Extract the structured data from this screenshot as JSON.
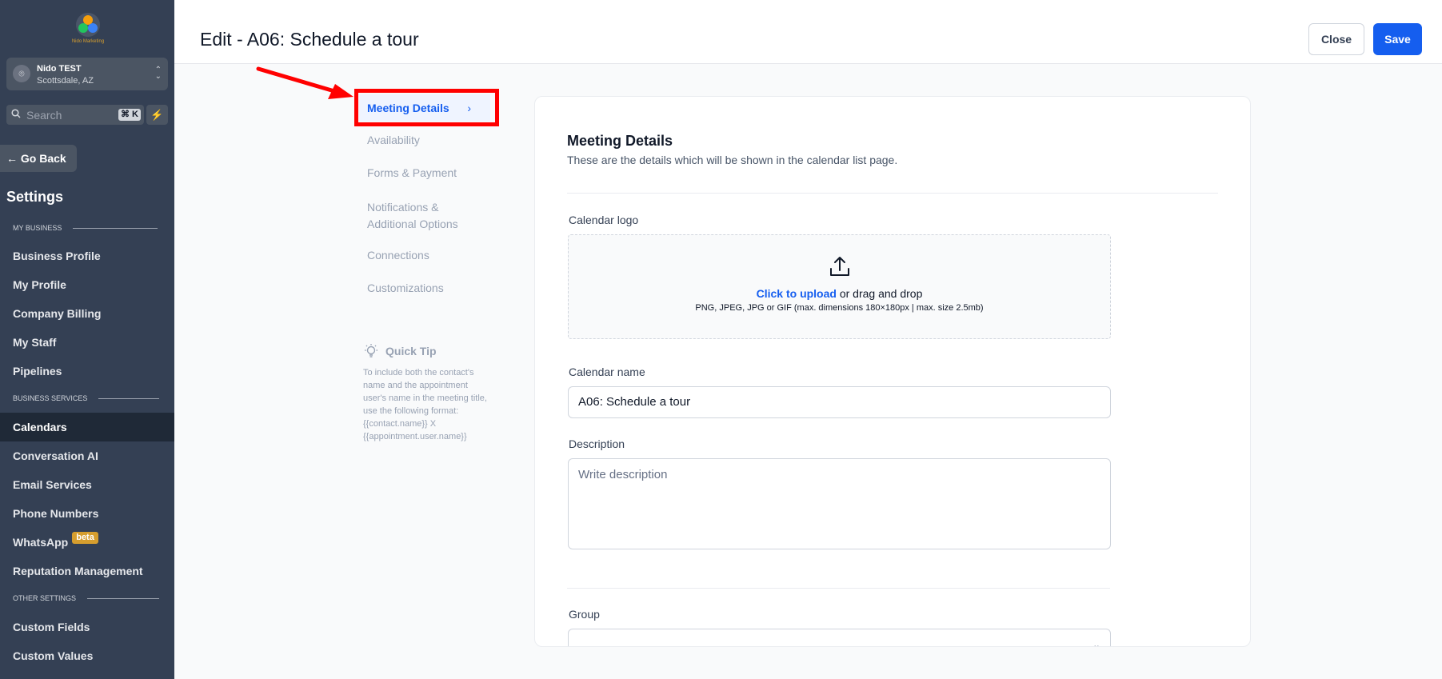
{
  "brand": {
    "logo_text": "Nido Marketing"
  },
  "account": {
    "name": "Nido TEST",
    "location": "Scottsdale, AZ"
  },
  "search": {
    "placeholder": "Search",
    "shortcut": "⌘ K"
  },
  "sidebar": {
    "go_back": "Go Back",
    "title": "Settings",
    "sections": {
      "my_business": "MY BUSINESS",
      "business_services": "BUSINESS SERVICES",
      "other_settings": "OTHER SETTINGS"
    },
    "items": [
      {
        "label": "Business Profile"
      },
      {
        "label": "My Profile"
      },
      {
        "label": "Company Billing"
      },
      {
        "label": "My Staff"
      },
      {
        "label": "Pipelines"
      },
      {
        "label": "Calendars"
      },
      {
        "label": "Conversation AI"
      },
      {
        "label": "Email Services"
      },
      {
        "label": "Phone Numbers"
      },
      {
        "label": "WhatsApp",
        "badge": "beta"
      },
      {
        "label": "Reputation Management"
      },
      {
        "label": "Custom Fields"
      },
      {
        "label": "Custom Values"
      }
    ]
  },
  "header": {
    "title": "Edit - A06: Schedule a tour",
    "close_label": "Close",
    "save_label": "Save"
  },
  "tabs": [
    {
      "label": "Meeting Details"
    },
    {
      "label": "Availability"
    },
    {
      "label": "Forms & Payment"
    },
    {
      "label": "Notifications & Additional Options"
    },
    {
      "label": "Connections"
    },
    {
      "label": "Customizations"
    }
  ],
  "quick_tip": {
    "title": "Quick Tip",
    "body": "To include both the contact's name and the appointment user's name in the meeting title, use the following format: {{contact.name}} X {{appointment.user.name}}"
  },
  "card": {
    "title": "Meeting Details",
    "subtitle": "These are the details which will be shown in the calendar list page.",
    "logo_label": "Calendar logo",
    "upload_link": "Click to upload",
    "upload_text": "or drag and drop",
    "upload_hint": "PNG, JPEG, JPG or GIF (max. dimensions 180×180px | max. size 2.5mb)",
    "name_label": "Calendar name",
    "name_value": "A06: Schedule a tour",
    "description_label": "Description",
    "description_placeholder": "Write description",
    "group_label": "Group"
  },
  "colors": {
    "sidebar_bg": "#344054",
    "accent": "#155eef",
    "annotation": "#ff0000"
  }
}
